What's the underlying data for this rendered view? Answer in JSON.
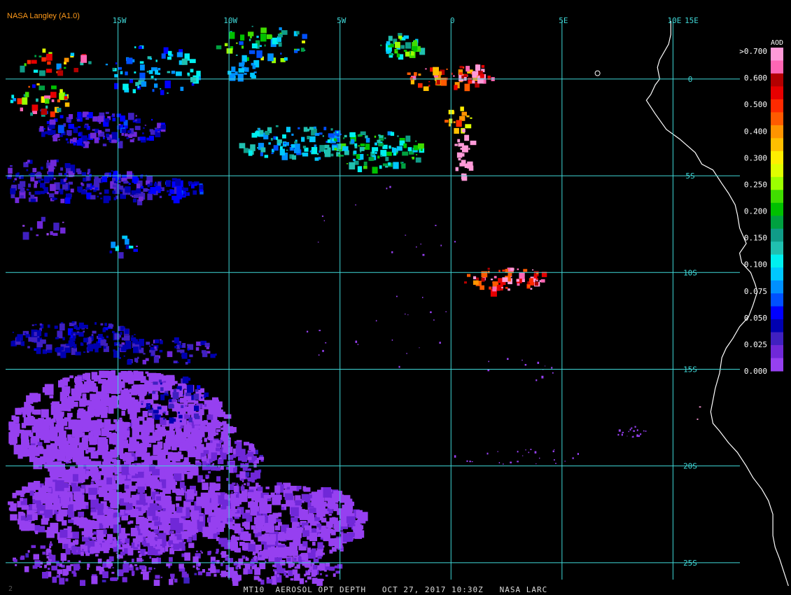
{
  "credit": "NASA Langley (A1.0)",
  "status_line": "MT10  AEROSOL OPT DEPTH   OCT 27, 2017 10:30Z   NASA LARC",
  "corner_mark": "2",
  "colors": {
    "grid": "#40d8d8",
    "coast": "#ffffff",
    "credit": "#ff9a1a"
  },
  "map": {
    "lon_range": [
      -20,
      15
    ],
    "lat_range": [
      -26.2,
      3
    ],
    "lon_labels": [
      {
        "lon": -15,
        "text": "15W"
      },
      {
        "lon": -10,
        "text": "10W"
      },
      {
        "lon": -5,
        "text": "5W"
      },
      {
        "lon": 0,
        "text": "0"
      },
      {
        "lon": 5,
        "text": "5E"
      },
      {
        "lon": 10,
        "text": "10E"
      },
      {
        "lon": 15,
        "text": "15E"
      }
    ],
    "lat_labels": [
      {
        "lat": 0,
        "text": "0"
      },
      {
        "lat": -5,
        "text": "5S"
      },
      {
        "lat": -10,
        "text": "10S"
      },
      {
        "lat": -15,
        "text": "15S"
      },
      {
        "lat": -20,
        "text": "20S"
      },
      {
        "lat": -25,
        "text": "25S"
      }
    ],
    "coastline": [
      [
        9.9,
        3.0
      ],
      [
        9.9,
        2.3
      ],
      [
        9.8,
        1.8
      ],
      [
        9.4,
        1.0
      ],
      [
        9.3,
        0.6
      ],
      [
        9.4,
        0.0
      ],
      [
        9.2,
        -0.3
      ],
      [
        9.0,
        -0.8
      ],
      [
        8.8,
        -1.1
      ],
      [
        9.2,
        -1.8
      ],
      [
        9.7,
        -2.6
      ],
      [
        10.3,
        -3.1
      ],
      [
        11.0,
        -3.8
      ],
      [
        11.3,
        -4.4
      ],
      [
        11.8,
        -4.7
      ],
      [
        12.2,
        -5.4
      ],
      [
        12.5,
        -5.9
      ],
      [
        12.8,
        -6.5
      ],
      [
        12.9,
        -7.0
      ],
      [
        13.0,
        -7.7
      ],
      [
        13.3,
        -8.5
      ],
      [
        13.0,
        -9.0
      ],
      [
        13.1,
        -9.5
      ],
      [
        13.5,
        -10.0
      ],
      [
        13.7,
        -10.6
      ],
      [
        13.8,
        -11.0
      ],
      [
        13.6,
        -11.7
      ],
      [
        13.4,
        -12.3
      ],
      [
        13.0,
        -12.8
      ],
      [
        12.7,
        -13.4
      ],
      [
        12.4,
        -13.9
      ],
      [
        12.2,
        -14.4
      ],
      [
        12.1,
        -15.2
      ],
      [
        11.9,
        -16.0
      ],
      [
        11.8,
        -16.6
      ],
      [
        11.7,
        -17.2
      ],
      [
        11.8,
        -17.8
      ],
      [
        12.1,
        -18.2
      ],
      [
        12.5,
        -18.8
      ],
      [
        12.9,
        -19.3
      ],
      [
        13.3,
        -20.0
      ],
      [
        13.6,
        -20.6
      ],
      [
        14.0,
        -21.2
      ],
      [
        14.3,
        -21.8
      ],
      [
        14.5,
        -22.5
      ],
      [
        14.5,
        -23.0
      ],
      [
        14.5,
        -23.6
      ],
      [
        14.6,
        -24.2
      ],
      [
        14.8,
        -24.8
      ],
      [
        15.0,
        -25.5
      ],
      [
        15.2,
        -26.2
      ]
    ],
    "legend": {
      "title": "AOD",
      "labels": [
        ">0.700",
        "0.600",
        "0.500",
        "0.400",
        "0.300",
        "0.250",
        "0.200",
        "0.150",
        "0.100",
        "0.075",
        "0.050",
        "0.025",
        "0.000"
      ],
      "colors": [
        "#ff9ad8",
        "#ff66b4",
        "#b30000",
        "#e60000",
        "#ff2a00",
        "#ff5a00",
        "#ff9400",
        "#ffbf00",
        "#ffee00",
        "#dfff00",
        "#9cff00",
        "#40dd00",
        "#00c000",
        "#00a040",
        "#109c88",
        "#20c0b0",
        "#00f0f0",
        "#00c8ff",
        "#0090ff",
        "#0050ff",
        "#0000ff",
        "#0000b0",
        "#4020c0",
        "#7028d8",
        "#9640f0"
      ]
    },
    "aerosol_clusters": [
      {
        "lon": -15.8,
        "lat": -2.5,
        "rlon": 2.8,
        "rlat": 0.9,
        "n": 160,
        "aod": [
          0.03,
          0.15
        ]
      },
      {
        "lon": -18.5,
        "lat": -5.2,
        "rlon": 2.5,
        "rlat": 1.1,
        "n": 140,
        "aod": [
          0.03,
          0.12
        ]
      },
      {
        "lon": -15.0,
        "lat": -5.5,
        "rlon": 2.0,
        "rlat": 0.8,
        "n": 110,
        "aod": [
          0.05,
          0.13
        ]
      },
      {
        "lon": -12.5,
        "lat": -5.6,
        "rlon": 1.3,
        "rlat": 0.5,
        "n": 45,
        "aod": [
          0.08,
          0.16
        ]
      },
      {
        "lon": -18.8,
        "lat": -1.0,
        "rlon": 1.5,
        "rlat": 0.8,
        "n": 40,
        "aod": [
          0.1,
          0.7
        ]
      },
      {
        "lon": -18.0,
        "lat": 1.0,
        "rlon": 1.8,
        "rlat": 0.6,
        "n": 30,
        "aod": [
          0.15,
          0.7
        ]
      },
      {
        "lon": -13.5,
        "lat": 0.5,
        "rlon": 2.2,
        "rlat": 1.3,
        "n": 70,
        "aod": [
          0.12,
          0.3
        ]
      },
      {
        "lon": -8.5,
        "lat": 1.8,
        "rlon": 2.2,
        "rlat": 1.0,
        "n": 55,
        "aod": [
          0.15,
          0.45
        ]
      },
      {
        "lon": -9.5,
        "lat": 0.5,
        "rlon": 0.7,
        "rlat": 0.5,
        "n": 18,
        "aod": [
          0.18,
          0.22
        ]
      },
      {
        "lon": -7.0,
        "lat": -3.2,
        "rlon": 2.6,
        "rlat": 0.9,
        "n": 110,
        "aod": [
          0.14,
          0.32
        ]
      },
      {
        "lon": -3.5,
        "lat": -3.6,
        "rlon": 2.2,
        "rlat": 1.0,
        "n": 110,
        "aod": [
          0.2,
          0.4
        ]
      },
      {
        "lon": -2.2,
        "lat": 1.8,
        "rlon": 1.0,
        "rlat": 0.6,
        "n": 40,
        "aod": [
          0.2,
          0.45
        ]
      },
      {
        "lon": -0.5,
        "lat": 0.2,
        "rlon": 1.6,
        "rlat": 0.7,
        "n": 40,
        "aod": [
          0.5,
          0.7
        ]
      },
      {
        "lon": 1.2,
        "lat": 0.3,
        "rlon": 0.9,
        "rlat": 0.6,
        "n": 30,
        "aod": [
          0.6,
          0.75
        ]
      },
      {
        "lon": 0.3,
        "lat": -2.0,
        "rlon": 0.6,
        "rlat": 0.6,
        "n": 16,
        "aod": [
          0.45,
          0.6
        ]
      },
      {
        "lon": 0.5,
        "lat": -3.7,
        "rlon": 0.4,
        "rlat": 1.3,
        "n": 25,
        "aod": [
          0.7,
          0.75
        ]
      },
      {
        "lon": -14.8,
        "lat": -8.5,
        "rlon": 0.8,
        "rlat": 0.6,
        "n": 12,
        "aod": [
          0.05,
          0.25
        ]
      },
      {
        "lon": -18.5,
        "lat": -7.5,
        "rlon": 1.2,
        "rlat": 0.6,
        "n": 12,
        "aod": [
          0.0,
          0.1
        ]
      },
      {
        "lon": 2.5,
        "lat": -10.3,
        "rlon": 2.0,
        "rlat": 0.6,
        "n": 70,
        "aod": [
          0.55,
          0.75
        ]
      },
      {
        "lon": 13.3,
        "lat": -12.0,
        "rlon": 0.2,
        "rlat": 0.3,
        "n": 8,
        "aod": [
          0.35,
          0.6
        ]
      },
      {
        "lon": 11.9,
        "lat": -13.6,
        "rlon": 0.5,
        "rlat": 0.3,
        "n": 12,
        "aod": [
          0.3,
          0.6
        ]
      },
      {
        "lon": -17.0,
        "lat": -13.3,
        "rlon": 3.0,
        "rlat": 0.8,
        "n": 150,
        "aod": [
          0.07,
          0.12
        ]
      },
      {
        "lon": -13.0,
        "lat": -14.0,
        "rlon": 2.5,
        "rlat": 0.7,
        "n": 80,
        "aod": [
          0.05,
          0.12
        ]
      },
      {
        "lon": -15.0,
        "lat": -18.0,
        "rlon": 5.0,
        "rlat": 3.0,
        "n": 900,
        "aod": [
          0.0,
          0.03
        ]
      },
      {
        "lon": -15.0,
        "lat": -22.0,
        "rlon": 5.0,
        "rlat": 2.2,
        "n": 650,
        "aod": [
          0.0,
          0.04
        ]
      },
      {
        "lon": -7.5,
        "lat": -22.8,
        "rlon": 3.5,
        "rlat": 2.0,
        "n": 420,
        "aod": [
          0.0,
          0.04
        ]
      },
      {
        "lon": -15.0,
        "lat": -24.8,
        "rlon": 5.0,
        "rlat": 1.2,
        "n": 260,
        "aod": [
          0.0,
          0.06
        ]
      },
      {
        "lon": -8.0,
        "lat": -25.3,
        "rlon": 3.0,
        "rlat": 0.8,
        "n": 140,
        "aod": [
          0.0,
          0.04
        ]
      },
      {
        "lon": -10.0,
        "lat": -20.0,
        "rlon": 1.5,
        "rlat": 1.5,
        "n": 120,
        "aod": [
          0.02,
          0.06
        ]
      },
      {
        "lon": -12.5,
        "lat": -16.5,
        "rlon": 1.5,
        "rlat": 1.2,
        "n": 60,
        "aod": [
          0.05,
          0.12
        ]
      },
      {
        "lon": 8.0,
        "lat": -18.2,
        "rlon": 0.8,
        "rlat": 0.3,
        "n": 20,
        "aod": [
          0.0,
          0.0
        ]
      },
      {
        "lon": 3.0,
        "lat": -19.5,
        "rlon": 3.0,
        "rlat": 0.5,
        "n": 25,
        "aod": [
          0.0,
          0.0
        ]
      },
      {
        "lon": 11.2,
        "lat": -17.3,
        "rlon": 0.3,
        "rlat": 0.4,
        "n": 10,
        "aod": [
          0.7,
          0.75
        ]
      },
      {
        "lon": 11.5,
        "lat": -19.0,
        "rlon": 0.3,
        "rlat": 0.5,
        "n": 18,
        "aod": [
          0.7,
          0.75
        ]
      },
      {
        "lon": 13.8,
        "lat": -23.8,
        "rlon": 0.15,
        "rlat": 0.8,
        "n": 25,
        "aod": [
          0.25,
          0.33
        ]
      },
      {
        "lon": 14.1,
        "lat": -25.8,
        "rlon": 0.2,
        "rlat": 0.2,
        "n": 10,
        "aod": [
          0.1,
          0.15
        ]
      },
      {
        "lon": -3.0,
        "lat": -13.0,
        "rlon": 4.0,
        "rlat": 2.0,
        "n": 20,
        "aod": [
          0.0,
          0.0
        ]
      },
      {
        "lon": 3.0,
        "lat": -15.0,
        "rlon": 2.0,
        "rlat": 0.6,
        "n": 12,
        "aod": [
          0.0,
          0.0
        ]
      },
      {
        "lon": -3.0,
        "lat": -7.5,
        "rlon": 4.0,
        "rlat": 2.0,
        "n": 14,
        "aod": [
          0.0,
          0.0
        ]
      }
    ]
  }
}
